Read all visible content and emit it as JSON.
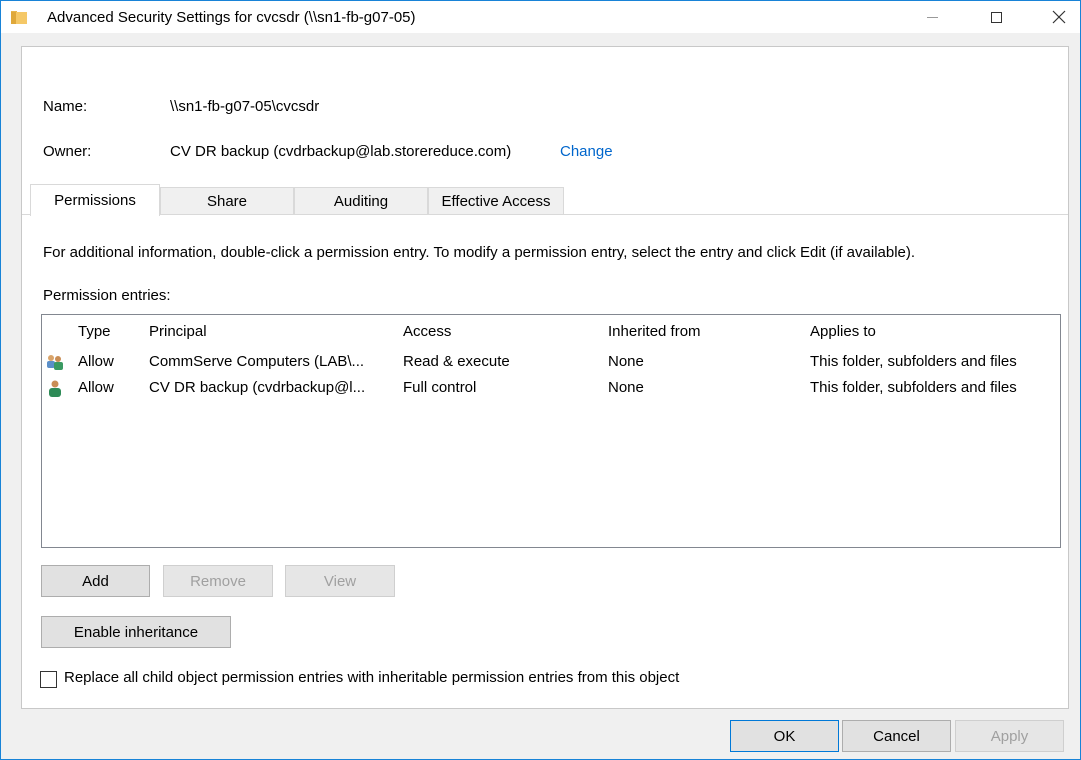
{
  "window": {
    "title": "Advanced Security Settings for cvcsdr (\\\\sn1-fb-g07-05)"
  },
  "fields": {
    "name_label": "Name:",
    "name_value": "\\\\sn1-fb-g07-05\\cvcsdr",
    "owner_label": "Owner:",
    "owner_value": "CV DR backup (cvdrbackup@lab.storereduce.com)",
    "owner_change_link": "Change"
  },
  "tabs": [
    {
      "label": "Permissions",
      "active": true
    },
    {
      "label": "Share",
      "active": false
    },
    {
      "label": "Auditing",
      "active": false
    },
    {
      "label": "Effective Access",
      "active": false
    }
  ],
  "info_text": "For additional information, double-click a permission entry. To modify a permission entry, select the entry and click Edit (if available).",
  "entries_label": "Permission entries:",
  "table": {
    "columns": [
      "Type",
      "Principal",
      "Access",
      "Inherited from",
      "Applies to"
    ],
    "rows": [
      {
        "icon": "group-users-icon",
        "type": "Allow",
        "principal": "CommServe Computers (LAB\\...",
        "access": "Read & execute",
        "inherited_from": "None",
        "applies_to": "This folder, subfolders and files"
      },
      {
        "icon": "user-icon",
        "type": "Allow",
        "principal": "CV DR backup (cvdrbackup@l...",
        "access": "Full control",
        "inherited_from": "None",
        "applies_to": "This folder, subfolders and files"
      }
    ]
  },
  "buttons": {
    "add": "Add",
    "remove": "Remove",
    "view": "View",
    "enable_inheritance": "Enable inheritance",
    "ok": "OK",
    "cancel": "Cancel",
    "apply": "Apply"
  },
  "replace_checkbox": {
    "label": "Replace all child object permission entries with inheritable permission entries from this object",
    "checked": false
  },
  "colors": {
    "accent": "#0078d7",
    "link": "#0066cc",
    "window_border": "#1883d7"
  }
}
